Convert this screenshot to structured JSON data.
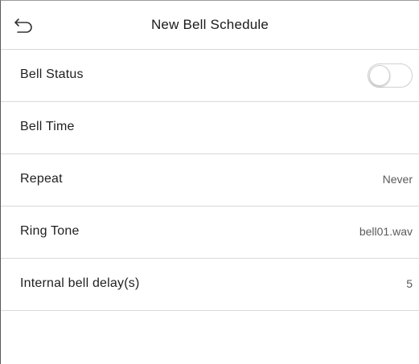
{
  "header": {
    "title": "New Bell Schedule",
    "back_icon": "back-arrow-icon"
  },
  "settings": {
    "bell_status": {
      "label": "Bell Status",
      "enabled": false
    },
    "bell_time": {
      "label": "Bell Time",
      "value": ""
    },
    "repeat": {
      "label": "Repeat",
      "value": "Never"
    },
    "ring_tone": {
      "label": "Ring Tone",
      "value": "bell01.wav"
    },
    "internal_delay": {
      "label": "Internal bell delay(s)",
      "value": "5"
    }
  },
  "colors": {
    "divider": "#d9d9d9",
    "text": "#1f1f1f",
    "value_text": "#5a5a5a",
    "toggle_border": "#cfcfcf"
  }
}
